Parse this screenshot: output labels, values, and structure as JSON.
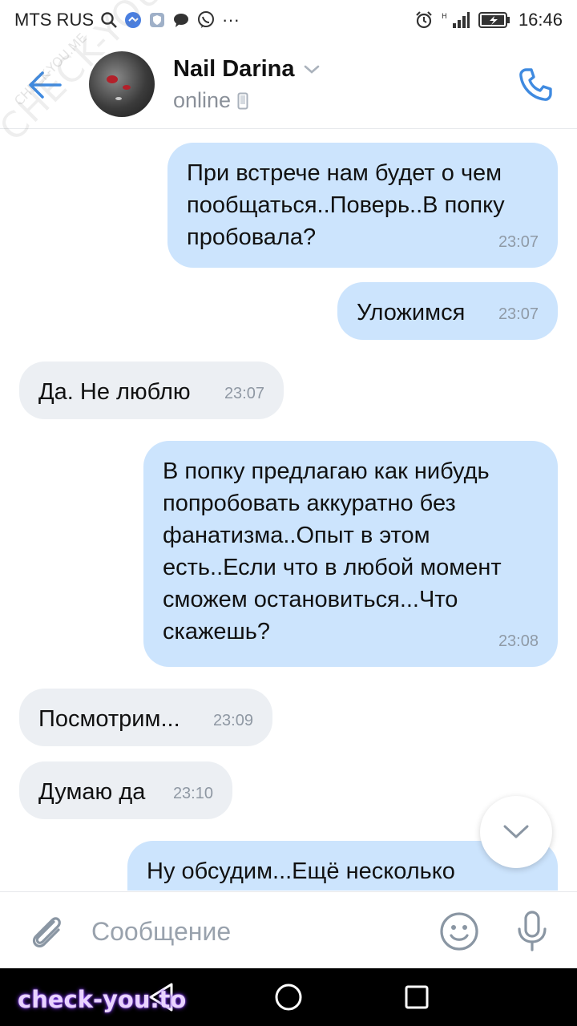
{
  "status_bar": {
    "carrier": "MTS RUS",
    "time": "16:46",
    "icons": [
      "search-icon",
      "app-icon",
      "shield-icon",
      "chat-icon",
      "viber-icon",
      "more-icon",
      "alarm-icon",
      "signal-icon",
      "battery-icon"
    ],
    "more": "···"
  },
  "header": {
    "contact_name": "Nail Darina",
    "status": "online",
    "accent": "#3f8ae0"
  },
  "messages": [
    {
      "direction": "out",
      "text": "При встрече нам будет о чем пообщаться..Поверь..В попку пробовала?",
      "time": "23:07"
    },
    {
      "direction": "out",
      "text": "Уложимся",
      "time": "23:07"
    },
    {
      "direction": "in",
      "text": "Да. Не люблю",
      "time": "23:07"
    },
    {
      "direction": "out",
      "text": "В попку предлагаю как нибудь попробовать аккуратно без фанатизма..Опыт в этом есть..Если что в любой момент сможем остановиться...Что скажешь?",
      "time": "23:08"
    },
    {
      "direction": "in",
      "text": "Посмотрим...",
      "time": "23:09"
    },
    {
      "direction": "in",
      "text": "Думаю да",
      "time": "23:10"
    },
    {
      "direction": "out",
      "text": "Ну обсудим...Ещё несколько",
      "time": ""
    }
  ],
  "composer": {
    "placeholder": "Сообщение"
  },
  "watermarks": {
    "diagonal": "CHECK-YOU.ME",
    "small": "CHECK-YOU.ME",
    "bottom": "check-you.to"
  },
  "colors": {
    "outgoing_bubble": "#cce4fd",
    "incoming_bubble": "#eceff3"
  }
}
